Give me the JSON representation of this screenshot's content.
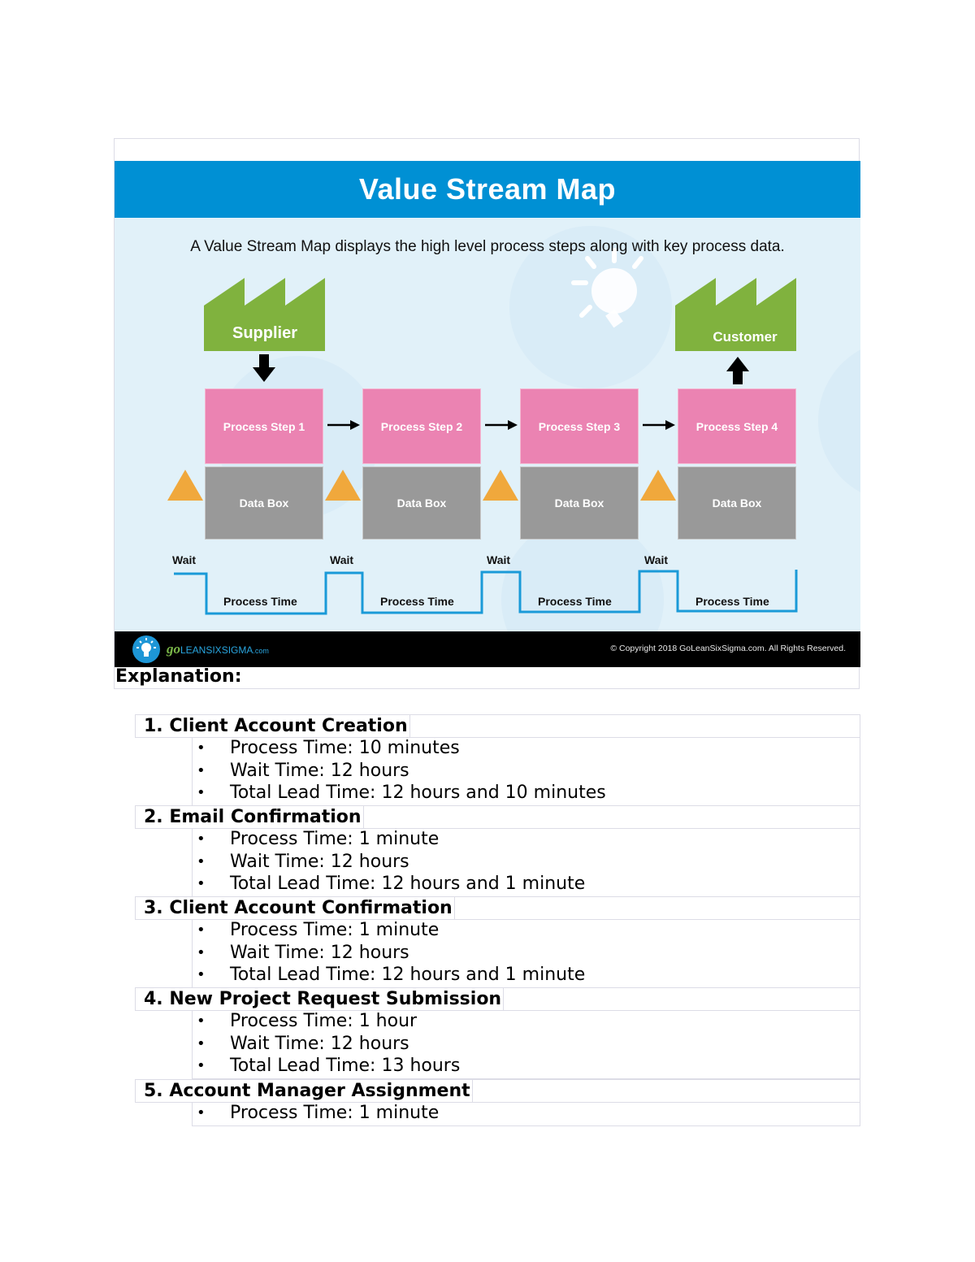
{
  "figure": {
    "title": "Value Stream Map",
    "subtitle": "A Value Stream Map displays the high level process steps along with key process data.",
    "supplier_label": "Supplier",
    "customer_label": "Customer",
    "process_steps": [
      "Process Step 1",
      "Process Step 2",
      "Process Step 3",
      "Process Step 4"
    ],
    "data_box_label": "Data Box",
    "wait_label": "Wait",
    "process_time_label": "Process Time",
    "footer": {
      "logo_go": "go",
      "logo_main": "LEANSIXSIGMA",
      "logo_suffix": ".com",
      "copyright": "© Copyright 2018 GoLeanSixSigma.com. All Rights Reserved."
    },
    "colors": {
      "header_blue": "#0090d4",
      "background": "#e1f1f9",
      "factory_green": "#80b23e",
      "process_pink": "#eb83b2",
      "databox_gray": "#999999",
      "inventory_orange": "#f0a83c",
      "timeline_blue": "#1a9ad8"
    }
  },
  "explanation_heading": "Explanation:",
  "steps": [
    {
      "title": "1. Client Account Creation",
      "bullets": [
        "Process Time: 10 minutes",
        "Wait Time: 12 hours",
        "Total Lead Time: 12 hours and 10 minutes"
      ]
    },
    {
      "title": "2. Email Confirmation",
      "bullets": [
        "Process Time: 1 minute",
        "Wait Time: 12 hours",
        "Total Lead Time: 12 hours and 1 minute"
      ]
    },
    {
      "title": "3. Client Account Confirmation",
      "bullets": [
        "Process Time: 1 minute",
        "Wait Time: 12 hours",
        "Total Lead Time: 12 hours and 1 minute"
      ]
    },
    {
      "title": "4. New Project Request Submission",
      "bullets": [
        "Process Time: 1 hour",
        "Wait Time: 12 hours",
        "Total Lead Time: 13 hours"
      ]
    },
    {
      "title": "5. Account Manager Assignment",
      "bullets": [
        "Process Time: 1 minute"
      ]
    }
  ],
  "bullet_glyph": "•"
}
